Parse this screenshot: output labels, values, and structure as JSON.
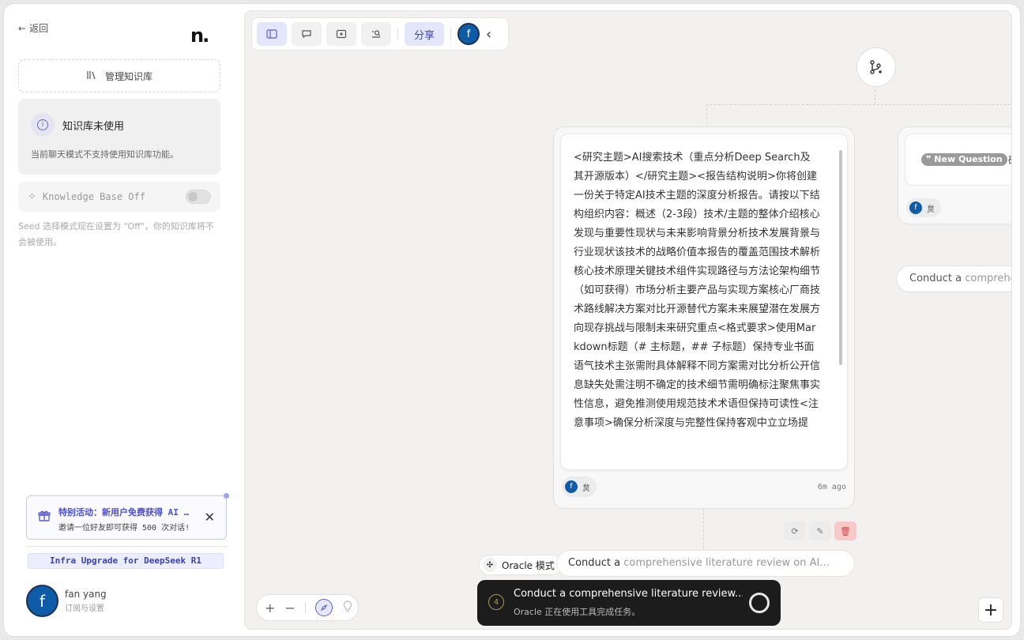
{
  "sidebar": {
    "back_label": "返回",
    "logo": "n.",
    "manage_kb_label": "管理知识库",
    "kb_card": {
      "title": "知识库未使用",
      "desc": "当前聊天模式不支持使用知识库功能。"
    },
    "kb_toggle": {
      "label": "Knowledge Base Off",
      "state": false
    },
    "seed_note": "Seed 选择模式现在设置为 \"Off\"，你的知识库将不会被使用。",
    "promo": {
      "title": "特别活动：新用户免费获得 AI 会员",
      "subtitle": "邀请一位好友即可获得 500 次对话!"
    },
    "infra_label": "Infra Upgrade for DeepSeek R1",
    "user": {
      "initial": "f",
      "name": "fan yang",
      "sub": "订阅与设置"
    }
  },
  "toolbar": {
    "share_label": "分享",
    "avatar_initial": "f"
  },
  "node_main": {
    "text": "<研究主题>AI搜索技术（重点分析Deep Search及其开源版本）</研究主题><报告结构说明>你将创建一份关于特定AI技术主题的深度分析报告。请按以下结构组织内容：概述（2-3段）技术/主题的整体介绍核心发现与重要性现状与未来影响背景分析技术发展背景与行业现状该技术的战略价值本报告的覆盖范围技术解析核心技术原理关键技术组件实现路径与方法论架构细节（如可获得）市场分析主要产品与实现方案核心厂商技术路线解决方案对比开源替代方案未来展望潜在发展方向现存挑战与限制未来研究重点<格式要求>使用Markdown标题（# 主标题，## 子标题）保持专业书面语气技术主张需附具体解释不同方案需对比分析公开信息缺失处需注明不确定的技术细节需明确标注聚焦事实性信息，避免推测使用规范技术术语但保持可读性<注意事项>确保分析深度与完整性保持客观中立立场提",
    "user_initial": "f",
    "user_name": "炱",
    "time": "6m ago"
  },
  "node_side": {
    "badge": "❞ New Question",
    "after_text": "研",
    "user_initial": "f",
    "user_name": "炱"
  },
  "side_pill": {
    "prefix": "Conduct a ",
    "rest": "comprehensive literature review on AI..."
  },
  "oracle_tag_label": "Oracle 模式",
  "prompt_pill": {
    "prefix": "Conduct a ",
    "rest": "comprehensive literature review on AI..."
  },
  "status": {
    "step": "4",
    "title": "Conduct a comprehensive literature review...",
    "subtitle": "Oracle 正在使用工具完成任务。"
  },
  "colors": {
    "accent": "#5b5fd8",
    "avatar": "#0e5ca8",
    "status_bg": "#1c1c1c",
    "delete": "#f7c9c9"
  }
}
